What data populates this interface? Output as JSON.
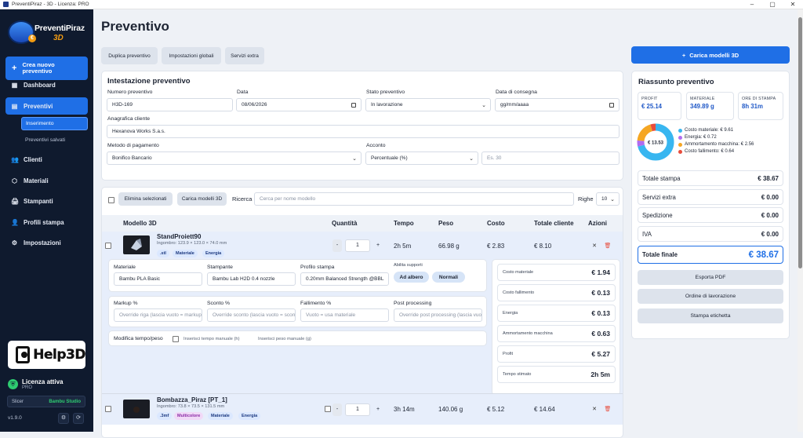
{
  "window": {
    "title": "PreventiPiraz - 3D - Licenza: PRO",
    "minimize": "–",
    "maximize": "▢",
    "close": "✕"
  },
  "sidebar": {
    "logo_line1": "PreventiPiraz",
    "logo_line2": "3D",
    "logo_badge": "€",
    "new_button": "Crea nuovo preventivo",
    "new_icon": "+",
    "items": [
      {
        "label": "Dashboard",
        "icon": "▦"
      },
      {
        "label": "Preventivi",
        "icon": "▤"
      },
      {
        "label": "Clienti",
        "icon": "👥"
      },
      {
        "label": "Materiali",
        "icon": "⬡"
      },
      {
        "label": "Stampanti",
        "icon": "🖨"
      },
      {
        "label": "Profili stampa",
        "icon": "👤"
      },
      {
        "label": "Impostazioni",
        "icon": "⚙"
      }
    ],
    "subitems": [
      {
        "label": "Inserimento"
      },
      {
        "label": "Preventivi salvati"
      }
    ],
    "help_text": "Help3D",
    "license_title": "Licenza attiva",
    "license_sub": "PRO",
    "license_icon": "⛨",
    "slicer_label": "Slicer",
    "slicer_value": "Bambu Studio",
    "version": "v1.9.0",
    "settings_icon": "⚙",
    "refresh_icon": "⟳"
  },
  "main": {
    "title": "Preventivo",
    "toolbar": [
      "Duplica preventivo",
      "Impostazioni globali",
      "Servizi extra"
    ],
    "header": {
      "title": "Intestazione preventivo",
      "numero_label": "Numero preventivo",
      "numero_value": "H3D-169",
      "data_label": "Data",
      "data_value": "08/06/2026",
      "stato_label": "Stato preventivo",
      "stato_value": "In lavorazione",
      "consegna_label": "Data di consegna",
      "consegna_value": "gg/mm/aaaa",
      "cliente_label": "Anagrafica cliente",
      "cliente_value": "Hexanova Works S.a.s.",
      "pagamento_label": "Metodo di pagamento",
      "pagamento_value": "Bonifico Bancario",
      "acconto_label": "Acconto",
      "acconto_value": "Percentuale (%)",
      "acconto_placeholder": "Es. 30"
    },
    "models": {
      "delete_selected": "Elimina selezionati",
      "load_models": "Carica modelli 3D",
      "search_label": "Ricerca",
      "search_placeholder": "Cerca per nome modello",
      "rows_label": "Righe",
      "rows_value": "10",
      "columns": [
        "Modello 3D",
        "Quantità",
        "Tempo",
        "Peso",
        "Costo",
        "Totale cliente",
        "Azioni"
      ],
      "items": [
        {
          "name": "StandProiett90",
          "dims": "Ingombro: 123.9 × 123.0 × 74.0 mm",
          "tags": [
            ".stl",
            "Materiale",
            "Energia"
          ],
          "qty": "1",
          "minus": "-",
          "plus": "+",
          "time": "2h 5m",
          "weight": "66.98 g",
          "cost": "€ 2.83",
          "total": "€ 8.10"
        },
        {
          "name": "Bombazza_Piraz [PT_1]",
          "dims": "Ingombro: 73.8 × 73.5 × 131.5 mm",
          "tags": [
            ".3mf",
            "Multicolore",
            "Materiale",
            "Energia"
          ],
          "qty": "1",
          "minus": "-",
          "plus": "+",
          "time": "3h 14m",
          "weight": "140.06 g",
          "cost": "€ 5.12",
          "total": "€ 14.64"
        }
      ],
      "detail": {
        "materiale_label": "Materiale",
        "materiale_value": "Bambu PLA Basic",
        "stampante_label": "Stampante",
        "stampante_value": "Bambu Lab H2D 0.4 nozzle",
        "profilo_label": "Profilo stampa",
        "profilo_value": "0.20mm Balanced Strength @BBL",
        "supporti_label": "Abilita supporti",
        "supporti_a": "Ad albero",
        "supporti_b": "Normali",
        "markup_label": "Markup %",
        "markup_ph": "Override riga (lascia vuoto = markup)",
        "sconto_label": "Sconto %",
        "sconto_ph": "Override sconto (lascia vuoto = sconto)",
        "fallimento_label": "Fallimento %",
        "fallimento_ph": "Vuoto = usa materiale",
        "post_label": "Post processing",
        "post_ph": "Override post processing (lascia vuoto)",
        "modifica_label": "Modifica tempo/peso",
        "tempo_manual": "Inserisci tempo manuale (h)",
        "peso_manual": "Inserisci peso manuale (g)",
        "costs": [
          {
            "label": "Costo materiale",
            "value": "€ 1.94"
          },
          {
            "label": "Costo fallimento",
            "value": "€ 0.13"
          },
          {
            "label": "Energia",
            "value": "€ 0.13"
          },
          {
            "label": "Ammortamento macchina",
            "value": "€ 0.63"
          },
          {
            "label": "Profit",
            "value": "€ 5.27"
          },
          {
            "label": "Tempo stimato",
            "value": "2h 5m"
          }
        ]
      }
    }
  },
  "summary": {
    "load_button": "Carica modelli 3D",
    "load_icon": "+",
    "title": "Riassunto preventivo",
    "kpis": [
      {
        "label": "PROFIT",
        "value": "€ 25.14"
      },
      {
        "label": "MATERIALE",
        "value": "349.89 g"
      },
      {
        "label": "ORE DI STAMPA",
        "value": "8h 31m"
      }
    ],
    "donut_center": "€ 13.53",
    "legend": [
      {
        "label": "Costo materiale: € 9.61",
        "color": "#38b6f0",
        "value": 9.61
      },
      {
        "label": "Energia: € 0.72",
        "color": "#b06cf0",
        "value": 0.72
      },
      {
        "label": "Ammortamento macchina: € 2.56",
        "color": "#f5a623",
        "value": 2.56
      },
      {
        "label": "Costo fallimento: € 0.64",
        "color": "#e74c3c",
        "value": 0.64
      }
    ],
    "rows": [
      {
        "label": "Totale stampa",
        "value": "€ 38.67"
      },
      {
        "label": "Servizi extra",
        "value": "€ 0.00"
      },
      {
        "label": "Spedizione",
        "value": "€ 0.00"
      },
      {
        "label": "IVA",
        "value": "€ 0.00"
      }
    ],
    "final_label": "Totale finale",
    "final_value": "€ 38.67",
    "exports": [
      "Esporta PDF",
      "Ordine di lavorazione",
      "Stampa etichetta"
    ]
  }
}
